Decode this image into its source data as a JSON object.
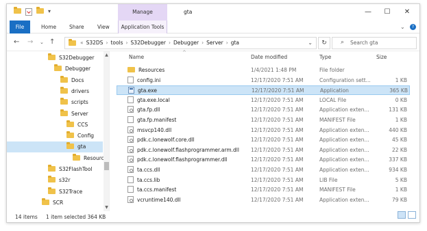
{
  "window": {
    "title": "gta",
    "manage_label": "Manage"
  },
  "ribbon": {
    "tabs": [
      "File",
      "Home",
      "Share",
      "View",
      "Application Tools"
    ]
  },
  "address": {
    "overflow": "«",
    "crumbs": [
      "S32DS",
      "tools",
      "S32Debugger",
      "Debugger",
      "Server",
      "gta"
    ],
    "separator": "›"
  },
  "search": {
    "placeholder": "Search gta"
  },
  "nav_tree": [
    {
      "label": "S32Debugger",
      "indent": 0
    },
    {
      "label": "Debugger",
      "indent": 1
    },
    {
      "label": "Docs",
      "indent": 2
    },
    {
      "label": "drivers",
      "indent": 2
    },
    {
      "label": "scripts",
      "indent": 2
    },
    {
      "label": "Server",
      "indent": 2
    },
    {
      "label": "CCS",
      "indent": 3
    },
    {
      "label": "Config",
      "indent": 3
    },
    {
      "label": "gta",
      "indent": 3,
      "selected": true
    },
    {
      "label": "Resources",
      "indent": 4
    },
    {
      "label": "S32FlashTool",
      "indent": 0
    },
    {
      "label": "s32r",
      "indent": 0
    },
    {
      "label": "S32Trace",
      "indent": 0
    },
    {
      "label": "SCR",
      "indent": -1
    }
  ],
  "columns": {
    "name": "Name",
    "date": "Date modified",
    "type": "Type",
    "size": "Size"
  },
  "files": [
    {
      "name": "Resources",
      "date": "1/4/2021 1:48 PM",
      "type": "File folder",
      "size": "",
      "icon": "folder"
    },
    {
      "name": "config.ini",
      "date": "12/17/2020 7:51 AM",
      "type": "Configuration sett...",
      "size": "1 KB",
      "icon": "file"
    },
    {
      "name": "gta.exe",
      "date": "12/17/2020 7:51 AM",
      "type": "Application",
      "size": "365 KB",
      "icon": "app",
      "selected": true
    },
    {
      "name": "gta.exe.local",
      "date": "12/17/2020 7:51 AM",
      "type": "LOCAL File",
      "size": "0 KB",
      "icon": "file"
    },
    {
      "name": "gta.fp.dll",
      "date": "12/17/2020 7:51 AM",
      "type": "Application exten...",
      "size": "131 KB",
      "icon": "dll"
    },
    {
      "name": "gta.fp.manifest",
      "date": "12/17/2020 7:51 AM",
      "type": "MANIFEST File",
      "size": "1 KB",
      "icon": "file"
    },
    {
      "name": "msvcp140.dll",
      "date": "12/17/2020 7:51 AM",
      "type": "Application exten...",
      "size": "440 KB",
      "icon": "dll"
    },
    {
      "name": "pdk.c.lonewolf.core.dll",
      "date": "12/17/2020 7:51 AM",
      "type": "Application exten...",
      "size": "45 KB",
      "icon": "dll"
    },
    {
      "name": "pdk.c.lonewolf.flashprogrammer.arm.dll",
      "date": "12/17/2020 7:51 AM",
      "type": "Application exten...",
      "size": "22 KB",
      "icon": "dll"
    },
    {
      "name": "pdk.c.lonewolf.flashprogrammer.dll",
      "date": "12/17/2020 7:51 AM",
      "type": "Application exten...",
      "size": "337 KB",
      "icon": "dll"
    },
    {
      "name": "ta.ccs.dll",
      "date": "12/17/2020 7:51 AM",
      "type": "Application exten...",
      "size": "934 KB",
      "icon": "dll"
    },
    {
      "name": "ta.ccs.lib",
      "date": "12/17/2020 7:51 AM",
      "type": "LIB File",
      "size": "5 KB",
      "icon": "file"
    },
    {
      "name": "ta.ccs.manifest",
      "date": "12/17/2020 7:51 AM",
      "type": "MANIFEST File",
      "size": "1 KB",
      "icon": "file"
    },
    {
      "name": "vcruntime140.dll",
      "date": "12/17/2020 7:51 AM",
      "type": "Application exten...",
      "size": "79 KB",
      "icon": "dll"
    }
  ],
  "status": {
    "items": "14 items",
    "selected": "1 item selected  364 KB"
  },
  "colors": {
    "accent": "#1a6fc4",
    "selection": "#cce4f7",
    "manage_bg": "#e4d7f5",
    "folder": "#f0c24a"
  }
}
